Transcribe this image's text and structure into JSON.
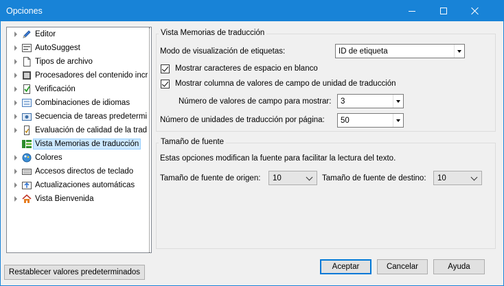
{
  "window": {
    "title": "Opciones"
  },
  "tree": {
    "items": [
      {
        "label": "Editor",
        "icon": "pencil-icon",
        "expandable": true
      },
      {
        "label": "AutoSuggest",
        "icon": "autosuggest-icon",
        "expandable": true
      },
      {
        "label": "Tipos de archivo",
        "icon": "file-icon",
        "expandable": true
      },
      {
        "label": "Procesadores del contenido incr",
        "icon": "processor-icon",
        "expandable": true
      },
      {
        "label": "Verificación",
        "icon": "verification-icon",
        "expandable": true
      },
      {
        "label": "Combinaciones de idiomas",
        "icon": "languages-icon",
        "expandable": true
      },
      {
        "label": "Secuencia de tareas predetermi",
        "icon": "task-sequence-icon",
        "expandable": true
      },
      {
        "label": "Evaluación de calidad de la trad",
        "icon": "quality-icon",
        "expandable": true
      },
      {
        "label": "Vista Memorias de traducción",
        "icon": "tm-view-icon",
        "expandable": false,
        "selected": true
      },
      {
        "label": "Colores",
        "icon": "colors-icon",
        "expandable": true
      },
      {
        "label": "Accesos directos de teclado",
        "icon": "keyboard-icon",
        "expandable": true
      },
      {
        "label": "Actualizaciones automáticas",
        "icon": "updates-icon",
        "expandable": true
      },
      {
        "label": "Vista Bienvenida",
        "icon": "home-icon",
        "expandable": true
      }
    ]
  },
  "tm_view": {
    "group_title": "Vista Memorias de traducción",
    "display_mode_label": "Modo de visualización de etiquetas:",
    "display_mode_value": "ID de etiqueta",
    "show_whitespace_label": "Mostrar caracteres de espacio en blanco",
    "show_whitespace_checked": true,
    "show_field_column_label": "Mostrar columna de valores de campo de unidad de traducción",
    "show_field_column_checked": true,
    "field_values_label": "Número de valores de campo para mostrar:",
    "field_values_value": "3",
    "units_per_page_label": "Número de unidades de traducción por página:",
    "units_per_page_value": "50"
  },
  "font_size": {
    "group_title": "Tamaño de fuente",
    "description": "Estas opciones modifican la fuente para facilitar la lectura del texto.",
    "source_label": "Tamaño de fuente de origen:",
    "source_value": "10",
    "target_label": "Tamaño de fuente de destino:",
    "target_value": "10"
  },
  "buttons": {
    "reset": "Restablecer valores predeterminados",
    "accept": "Aceptar",
    "cancel": "Cancelar",
    "help": "Ayuda"
  }
}
